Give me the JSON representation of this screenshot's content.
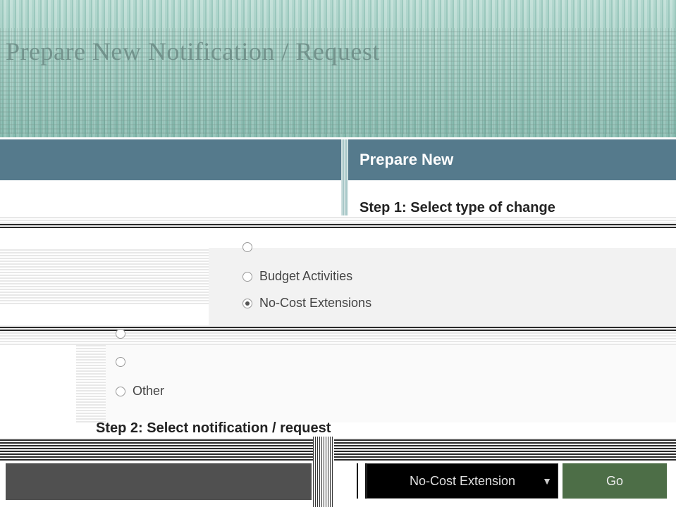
{
  "page": {
    "title": "Prepare New Notification / Request"
  },
  "header": {
    "right_title": "Prepare New"
  },
  "step1": {
    "label": "Step 1:  Select type of change",
    "options": [
      {
        "label": "",
        "checked": false
      },
      {
        "label": "Budget Activities",
        "checked": false
      },
      {
        "label": "No-Cost Extensions",
        "checked": true
      },
      {
        "label": "",
        "checked": false
      },
      {
        "label": "",
        "checked": false
      },
      {
        "label": "Other",
        "checked": false
      }
    ]
  },
  "step2": {
    "label": "Step 2:  Select notification / request",
    "select_value": "No-Cost Extension",
    "go_label": "Go"
  }
}
